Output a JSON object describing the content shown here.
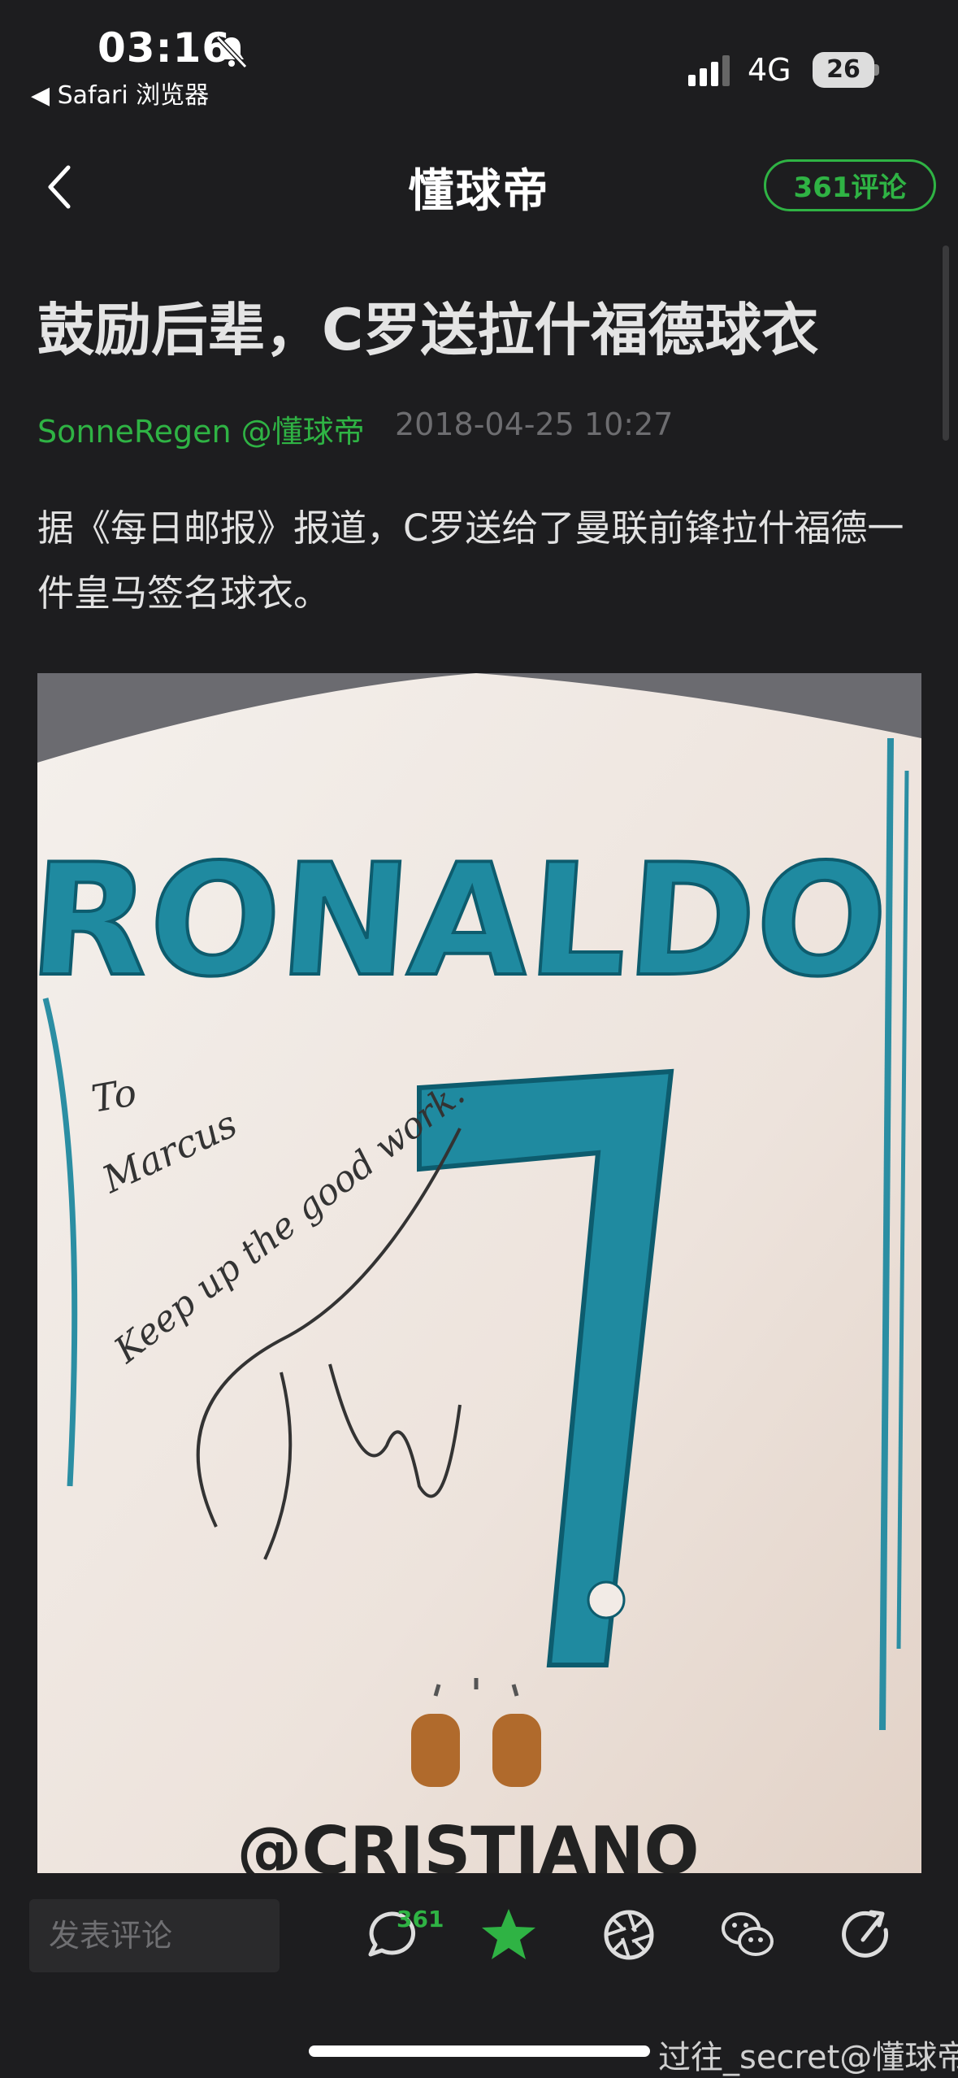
{
  "status_bar": {
    "time": "03:16",
    "back_app": "◀ Safari 浏览器",
    "network": "4G",
    "battery": "26"
  },
  "nav": {
    "title": "懂球帝",
    "comment_button": "361评论"
  },
  "article": {
    "title": "鼓励后辈，C罗送拉什福德球衣",
    "author": "SonneRegen @懂球帝",
    "date": "2018-04-25 10:27",
    "body": "据《每日邮报》报道，C罗送给了曼联前锋拉什福德一件皇马签名球衣。"
  },
  "photo": {
    "jersey_name": "RONALDO",
    "jersey_number": "7",
    "handwriting_lines": [
      "To",
      "Marcus",
      "Keep up the good work."
    ],
    "handle_text": "@CRISTIANO"
  },
  "toolbar": {
    "comment_placeholder": "发表评论",
    "comment_count": "361",
    "icons": [
      "comment-icon",
      "star-icon",
      "camera-shutter-icon",
      "wechat-icon",
      "share-icon"
    ],
    "accent_color": "#2fb344"
  },
  "watermark": "过往_secret@懂球帝"
}
